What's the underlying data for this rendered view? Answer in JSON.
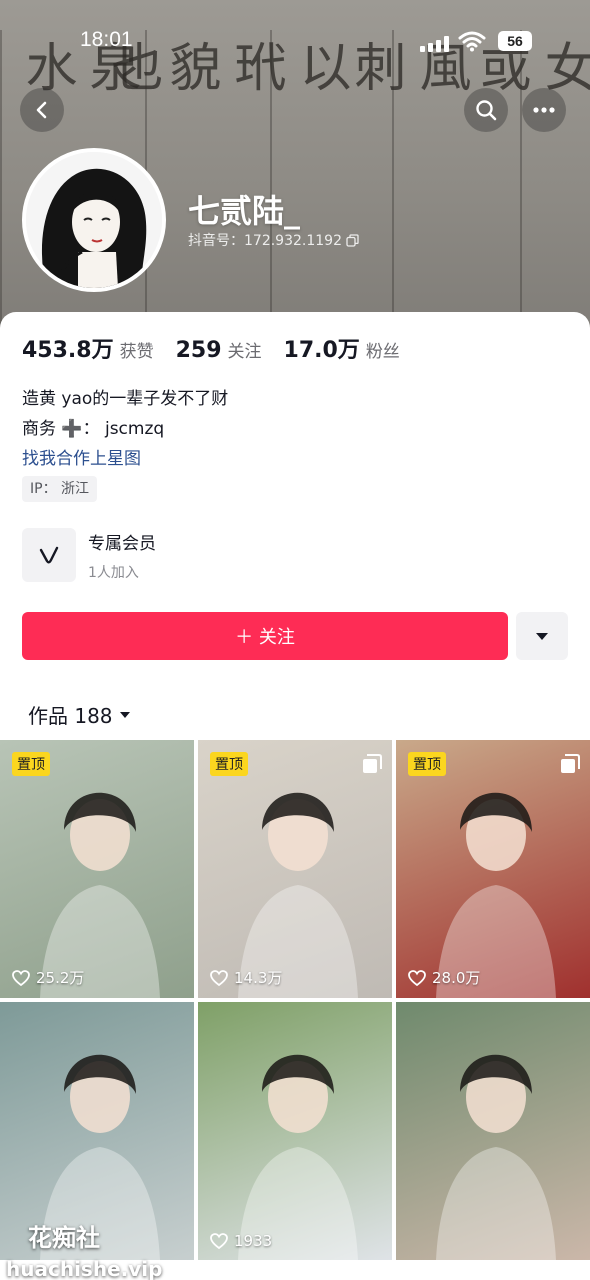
{
  "status_bar": {
    "time": "18:01",
    "battery": "56"
  },
  "profile": {
    "nickname": "七贰陆_",
    "douyin_id": "抖音号：172.932.1192",
    "avatar_desc": "avatar"
  },
  "stats": [
    {
      "num": "453.8万",
      "label": "获赞"
    },
    {
      "num": "259",
      "label": "关注"
    },
    {
      "num": "17.0万",
      "label": "粉丝"
    }
  ],
  "bio": {
    "line1": "造黄 yao的一辈子发不了财",
    "line2": "商务 ➕：  jscmzq",
    "link": "找我合作上星图"
  },
  "ip_tag": "IP： 浙江",
  "membership": {
    "title": "专属会员",
    "subtitle": "1人加入"
  },
  "follow_button": "＋ 关注",
  "works_tab": "作品 188",
  "grid": [
    {
      "pinned": "置顶",
      "likes": "25.2万",
      "multi": false,
      "colors": [
        "#b8c4b6",
        "#8fa08c"
      ]
    },
    {
      "pinned": "置顶",
      "likes": "14.3万",
      "multi": true,
      "colors": [
        "#d9d3c9",
        "#bfbab4"
      ]
    },
    {
      "pinned": "置顶",
      "likes": "28.0万",
      "multi": true,
      "colors": [
        "#c9a98a",
        "#a0302e"
      ]
    },
    {
      "pinned": "",
      "likes": "",
      "multi": false,
      "colors": [
        "#7e9a98",
        "#c7cfcf"
      ]
    },
    {
      "pinned": "",
      "likes": "1933",
      "multi": false,
      "colors": [
        "#7fa067",
        "#dfe3e7"
      ]
    },
    {
      "pinned": "",
      "likes": "",
      "multi": false,
      "colors": [
        "#6f8a6d",
        "#cbb7a9"
      ]
    }
  ],
  "watermark": {
    "line1": "花痴社",
    "line2": "huachishe.vip"
  },
  "accent": "#fe2c55"
}
